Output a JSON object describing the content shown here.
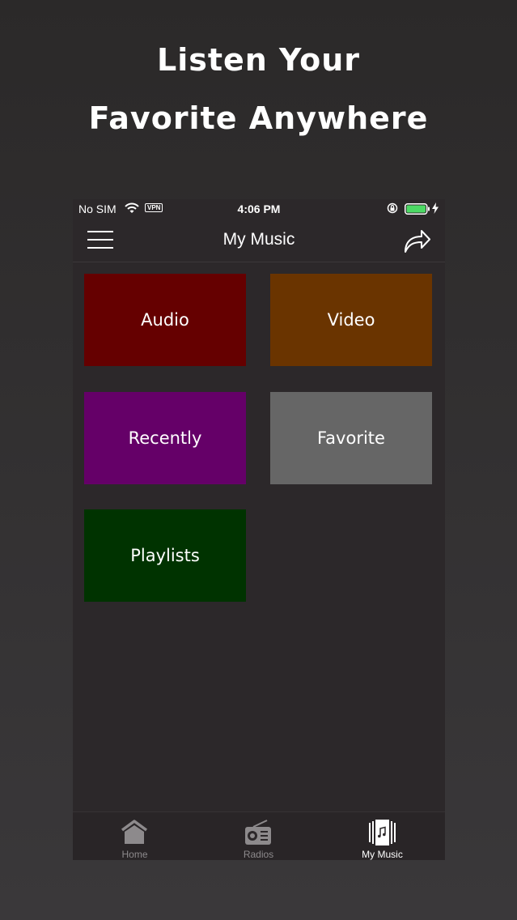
{
  "promo": {
    "line1": "Listen Your",
    "line2": "Favorite Anywhere"
  },
  "status_bar": {
    "carrier": "No SIM",
    "vpn": "VPN",
    "time": "4:06 PM"
  },
  "nav": {
    "title": "My Music"
  },
  "tiles": [
    {
      "label": "Audio",
      "color": "#650000"
    },
    {
      "label": "Video",
      "color": "#6a3400"
    },
    {
      "label": "Recently",
      "color": "#650068"
    },
    {
      "label": "Favorite",
      "color": "#666666"
    },
    {
      "label": "Playlists",
      "color": "#003300"
    }
  ],
  "tabs": [
    {
      "label": "Home",
      "icon": "home-icon"
    },
    {
      "label": "Radios",
      "icon": "radio-icon"
    },
    {
      "label": "My Music",
      "icon": "music-library-icon",
      "selected": true
    }
  ],
  "colors": {
    "battery": "#4cd964"
  }
}
